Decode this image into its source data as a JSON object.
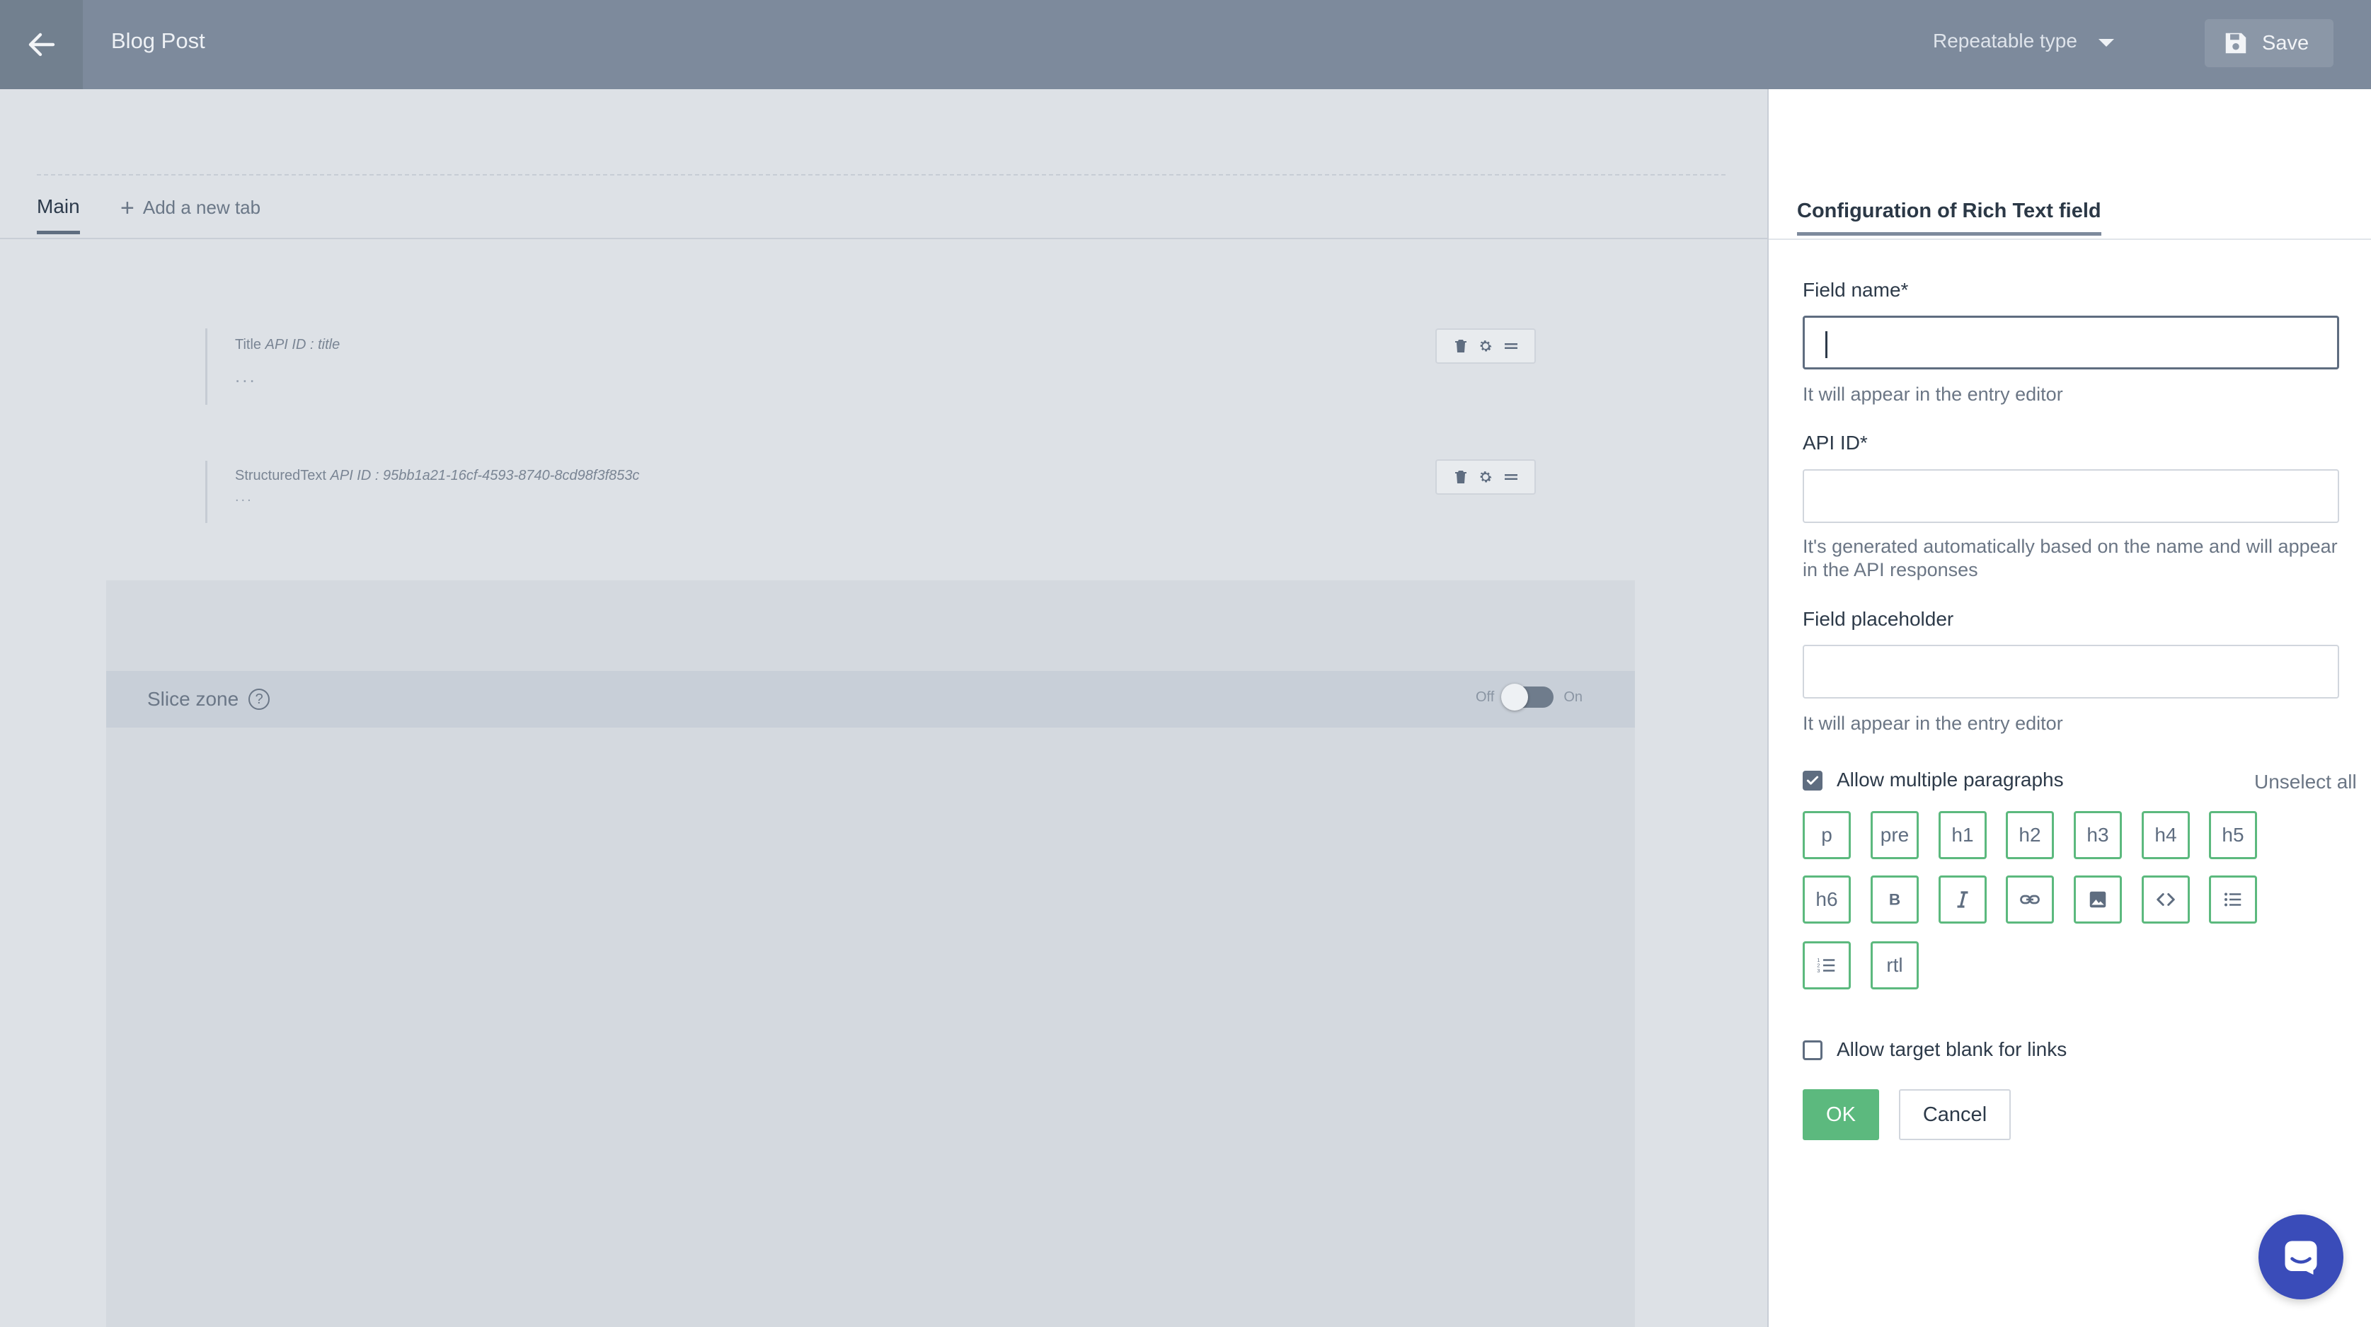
{
  "header": {
    "title": "Blog Post",
    "type_select": "Repeatable type",
    "save_label": "Save"
  },
  "tabs": {
    "main": "Main",
    "add": "Add a new tab"
  },
  "fields": [
    {
      "type": "Title",
      "api_id": "API ID : title",
      "preview": "..."
    },
    {
      "type": "StructuredText",
      "api_id": "API ID : 95bb1a21-16cf-4593-8740-8cd98f3f853c",
      "preview": "..."
    }
  ],
  "slice_zone": {
    "label": "Slice zone",
    "help": "?",
    "off": "Off",
    "on": "On",
    "enabled": false
  },
  "panel": {
    "tab": "Configuration of Rich Text field",
    "field_name_label": "Field name*",
    "field_name_value": "",
    "field_name_hint": "It will appear in the entry editor",
    "api_id_label": "API ID*",
    "api_id_value": "",
    "api_id_hint": "It's generated automatically based on the name and will appear in the API responses",
    "placeholder_label": "Field placeholder",
    "placeholder_value": "",
    "placeholder_hint": "It will appear in the entry editor",
    "allow_multiple_label": "Allow multiple paragraphs",
    "allow_multiple_checked": true,
    "unselect_all": "Unselect all",
    "formats": [
      "p",
      "pre",
      "h1",
      "h2",
      "h3",
      "h4",
      "h5",
      "h6",
      "bold-icon",
      "italic-icon",
      "link-icon",
      "image-icon",
      "code-icon",
      "bullet-list-icon",
      "numbered-list-icon",
      "rtl"
    ],
    "target_blank_label": "Allow target blank for links",
    "target_blank_checked": false,
    "ok_label": "OK",
    "cancel_label": "Cancel"
  },
  "colors": {
    "topbar": "#7d8a9c",
    "accent_green": "#5cb97e",
    "chat": "#3a4cb9"
  }
}
